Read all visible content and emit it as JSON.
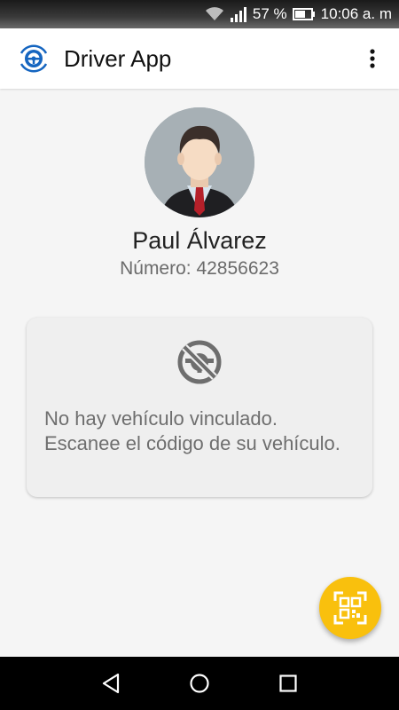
{
  "status_bar": {
    "battery": "57 %",
    "time": "10:06 a. m",
    "icons": [
      "wifi-icon",
      "signal-icon",
      "battery-icon"
    ]
  },
  "app_bar": {
    "title": "Driver App",
    "logo_icon": "steering-wheel-icon",
    "menu_icon": "more-vert-icon"
  },
  "profile": {
    "name": "Paul Álvarez",
    "number": "Número: 42856623"
  },
  "vehicle_card": {
    "icon": "no-vehicle-icon",
    "message": "No hay vehículo vinculado. Escanee el código de su vehículo."
  },
  "fab": {
    "icon": "qr-code-scan-icon"
  },
  "colors": {
    "accent": "#f9c00d",
    "logo_blue": "#1565c0",
    "card_bg": "#efefef",
    "page_bg": "#f5f5f5"
  },
  "nav_bar": {
    "icons": [
      "back-icon",
      "home-icon",
      "recents-icon"
    ]
  }
}
